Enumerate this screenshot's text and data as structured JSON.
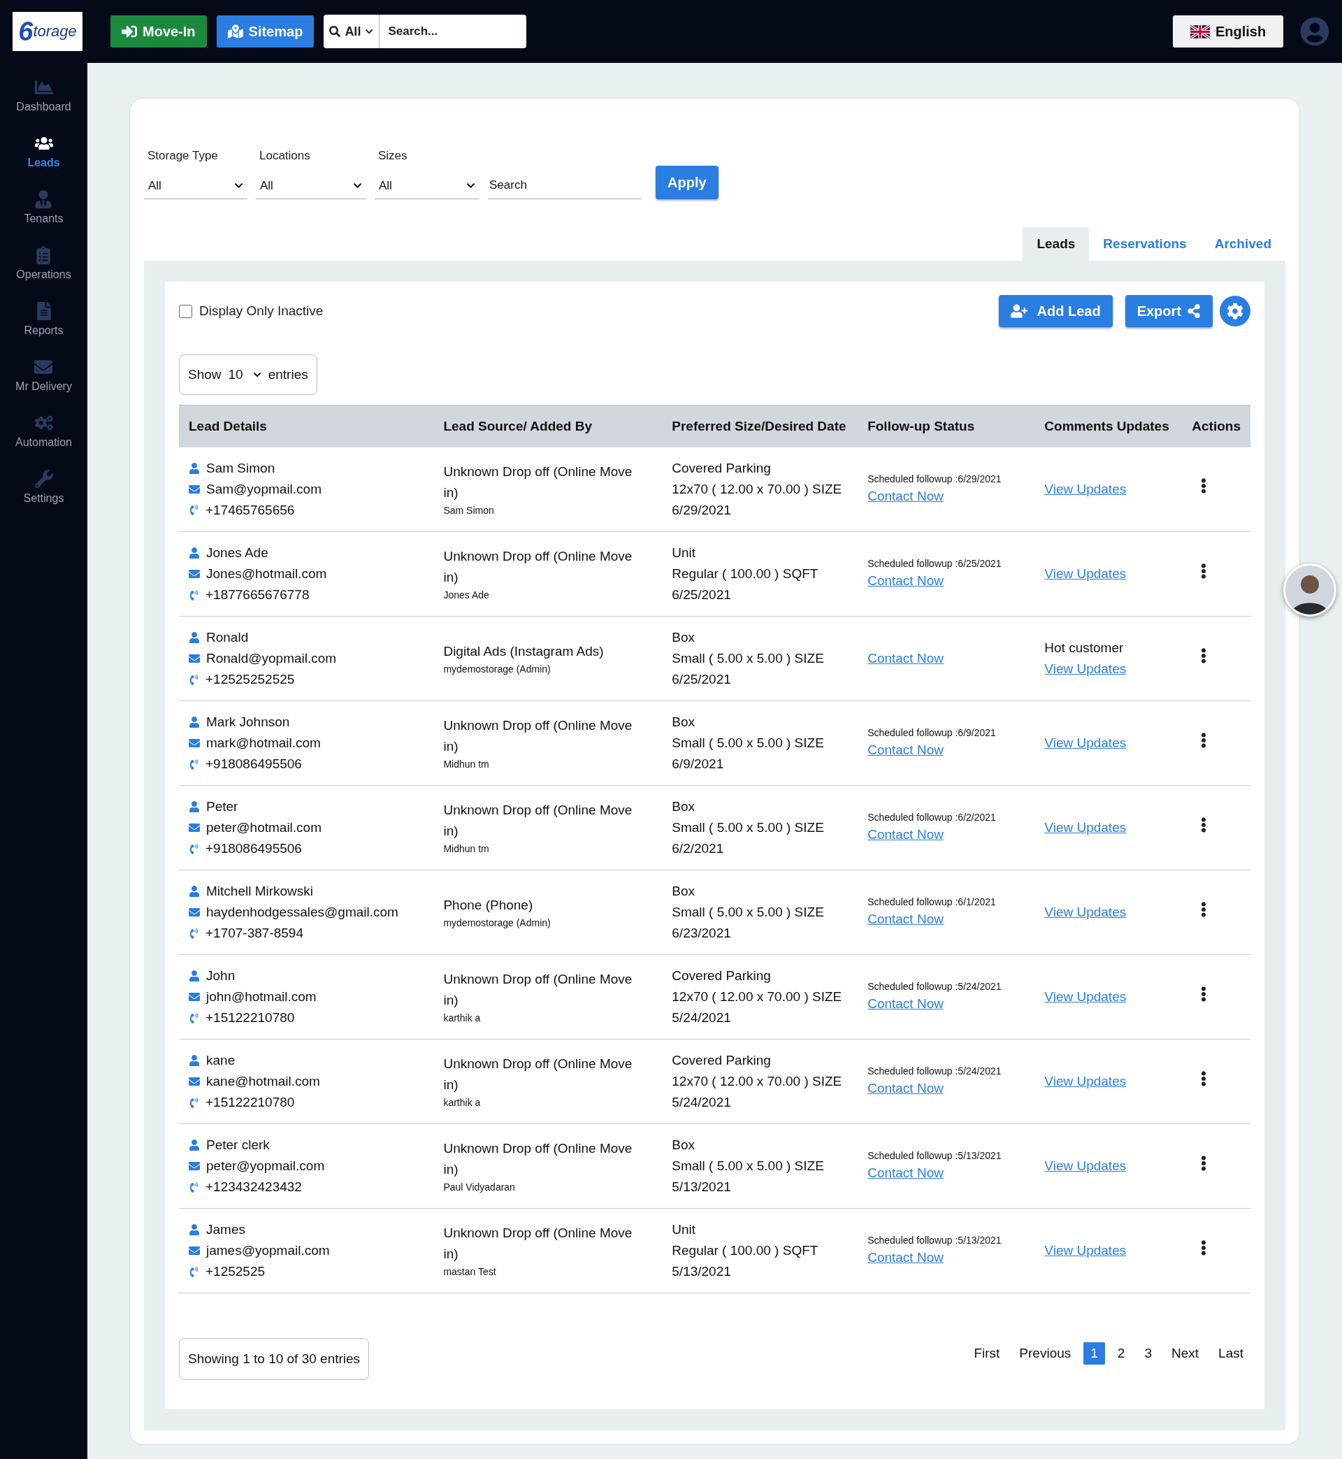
{
  "header": {
    "logo": {
      "mark": "6",
      "text": "torage"
    },
    "buttons": [
      {
        "label": "Move-In",
        "kind": "move-in"
      },
      {
        "label": "Sitemap",
        "kind": "sitemap"
      }
    ],
    "search": {
      "scope": "All",
      "placeholder": "Search..."
    },
    "language": "English"
  },
  "sidebar": {
    "items": [
      {
        "label": "Dashboard",
        "selected": false
      },
      {
        "label": "Leads",
        "selected": true
      },
      {
        "label": "Tenants",
        "selected": false
      },
      {
        "label": "Operations",
        "selected": false
      },
      {
        "label": "Reports",
        "selected": false
      },
      {
        "label": "Mr Delivery",
        "selected": false
      },
      {
        "label": "Automation",
        "selected": false
      },
      {
        "label": "Settings",
        "selected": false
      }
    ]
  },
  "filters": {
    "selects": [
      {
        "label": "Storage Type",
        "value": "All"
      },
      {
        "label": "Locations",
        "value": "All"
      },
      {
        "label": "Sizes",
        "value": "All"
      }
    ],
    "search": {
      "placeholder": "Search"
    },
    "apply": "Apply"
  },
  "tabs": [
    {
      "label": "Leads",
      "selected": true
    },
    {
      "label": "Reservations",
      "selected": false
    },
    {
      "label": "Archived",
      "selected": false
    }
  ],
  "inactive_filter": {
    "label": "Display Only Inactive",
    "checked": false
  },
  "toolbar": {
    "add_lead": "Add Lead",
    "export": "Export"
  },
  "page_size": {
    "prefix": "Show",
    "value": "10",
    "suffix": "entries"
  },
  "table": {
    "columns": [
      "Lead Details",
      "Lead Source/ Added By",
      "Preferred Size/Desired Date",
      "Follow-up Status",
      "Comments Updates",
      "Actions"
    ],
    "rows": [
      {
        "name": "Sam Simon",
        "email": "Sam@yopmail.com",
        "phone": "+17465765656",
        "source": "Unknown Drop off (Online Move in)",
        "added_by": "Sam Simon",
        "size_type": "Covered Parking",
        "size": "12x70 ( 12.00 x 70.00 ) SIZE",
        "date": "6/29/2021",
        "followup": "Scheduled followup :6/29/2021",
        "contact": "Contact Now",
        "updates": "View Updates"
      },
      {
        "name": "Jones Ade",
        "email": "Jones@hotmail.com",
        "phone": "+1877665676778",
        "source": "Unknown Drop off (Online Move in)",
        "added_by": "Jones Ade",
        "size_type": "Unit",
        "size": "Regular ( 100.00 ) SQFT",
        "date": "6/25/2021",
        "followup": "Scheduled followup :6/25/2021",
        "contact": "Contact Now",
        "updates": "View Updates"
      },
      {
        "name": "Ronald",
        "email": "Ronald@yopmail.com",
        "phone": "+12525252525",
        "source": "Digital Ads (Instagram Ads)",
        "added_by": "mydemostorage (Admin)",
        "size_type": "Box",
        "size": "Small ( 5.00 x 5.00 ) SIZE",
        "date": "6/25/2021",
        "contact": "Contact Now",
        "comment": "Hot customer",
        "updates": "View Updates"
      },
      {
        "name": "Mark Johnson",
        "email": "mark@hotmail.com",
        "phone": "+918086495506",
        "source": "Unknown Drop off (Online Move in)",
        "added_by": "Midhun tm",
        "size_type": "Box",
        "size": "Small ( 5.00 x 5.00 ) SIZE",
        "date": "6/9/2021",
        "followup": "Scheduled followup :6/9/2021",
        "contact": "Contact Now",
        "updates": "View Updates"
      },
      {
        "name": "Peter",
        "email": "peter@hotmail.com",
        "phone": "+918086495506",
        "source": "Unknown Drop off (Online Move in)",
        "added_by": "Midhun tm",
        "size_type": "Box",
        "size": "Small ( 5.00 x 5.00 ) SIZE",
        "date": "6/2/2021",
        "followup": "Scheduled followup :6/2/2021",
        "contact": "Contact Now",
        "updates": "View Updates"
      },
      {
        "name": "Mitchell Mirkowski",
        "email": "haydenhodgessales@gmail.com",
        "phone": "+1707-387-8594",
        "source": "Phone (Phone)",
        "added_by": "mydemostorage (Admin)",
        "size_type": "Box",
        "size": "Small ( 5.00 x 5.00 ) SIZE",
        "date": "6/23/2021",
        "followup": "Scheduled followup :6/1/2021",
        "contact": "Contact Now",
        "updates": "View Updates"
      },
      {
        "name": "John",
        "email": "john@hotmail.com",
        "phone": "+15122210780",
        "source": "Unknown Drop off (Online Move in)",
        "added_by": "karthik a",
        "size_type": "Covered Parking",
        "size": "12x70 ( 12.00 x 70.00 ) SIZE",
        "date": "5/24/2021",
        "followup": "Scheduled followup :5/24/2021",
        "contact": "Contact Now",
        "updates": "View Updates"
      },
      {
        "name": "kane",
        "email": "kane@hotmail.com",
        "phone": "+15122210780",
        "source": "Unknown Drop off (Online Move in)",
        "added_by": "karthik a",
        "size_type": "Covered Parking",
        "size": "12x70 ( 12.00 x 70.00 ) SIZE",
        "date": "5/24/2021",
        "followup": "Scheduled followup :5/24/2021",
        "contact": "Contact Now",
        "updates": "View Updates"
      },
      {
        "name": "Peter clerk",
        "email": "peter@yopmail.com",
        "phone": "+123432423432",
        "source": "Unknown Drop off (Online Move in)",
        "added_by": "Paul Vidyadaran",
        "size_type": "Box",
        "size": "Small ( 5.00 x 5.00 ) SIZE",
        "date": "5/13/2021",
        "followup": "Scheduled followup :5/13/2021",
        "contact": "Contact Now",
        "updates": "View Updates"
      },
      {
        "name": "James",
        "email": "james@yopmail.com",
        "phone": "+1252525",
        "source": "Unknown Drop off (Online Move in)",
        "added_by": "mastan Test",
        "size_type": "Unit",
        "size": "Regular ( 100.00 ) SQFT",
        "date": "5/13/2021",
        "followup": "Scheduled followup :5/13/2021",
        "contact": "Contact Now",
        "updates": "View Updates"
      }
    ]
  },
  "footer": {
    "info": "Showing 1 to 10 of 30 entries",
    "pagination": [
      {
        "label": "First",
        "selected": false
      },
      {
        "label": "Previous",
        "selected": false
      },
      {
        "label": "1",
        "selected": true
      },
      {
        "label": "2",
        "selected": false
      },
      {
        "label": "3",
        "selected": false
      },
      {
        "label": "Next",
        "selected": false
      },
      {
        "label": "Last",
        "selected": false
      }
    ]
  }
}
